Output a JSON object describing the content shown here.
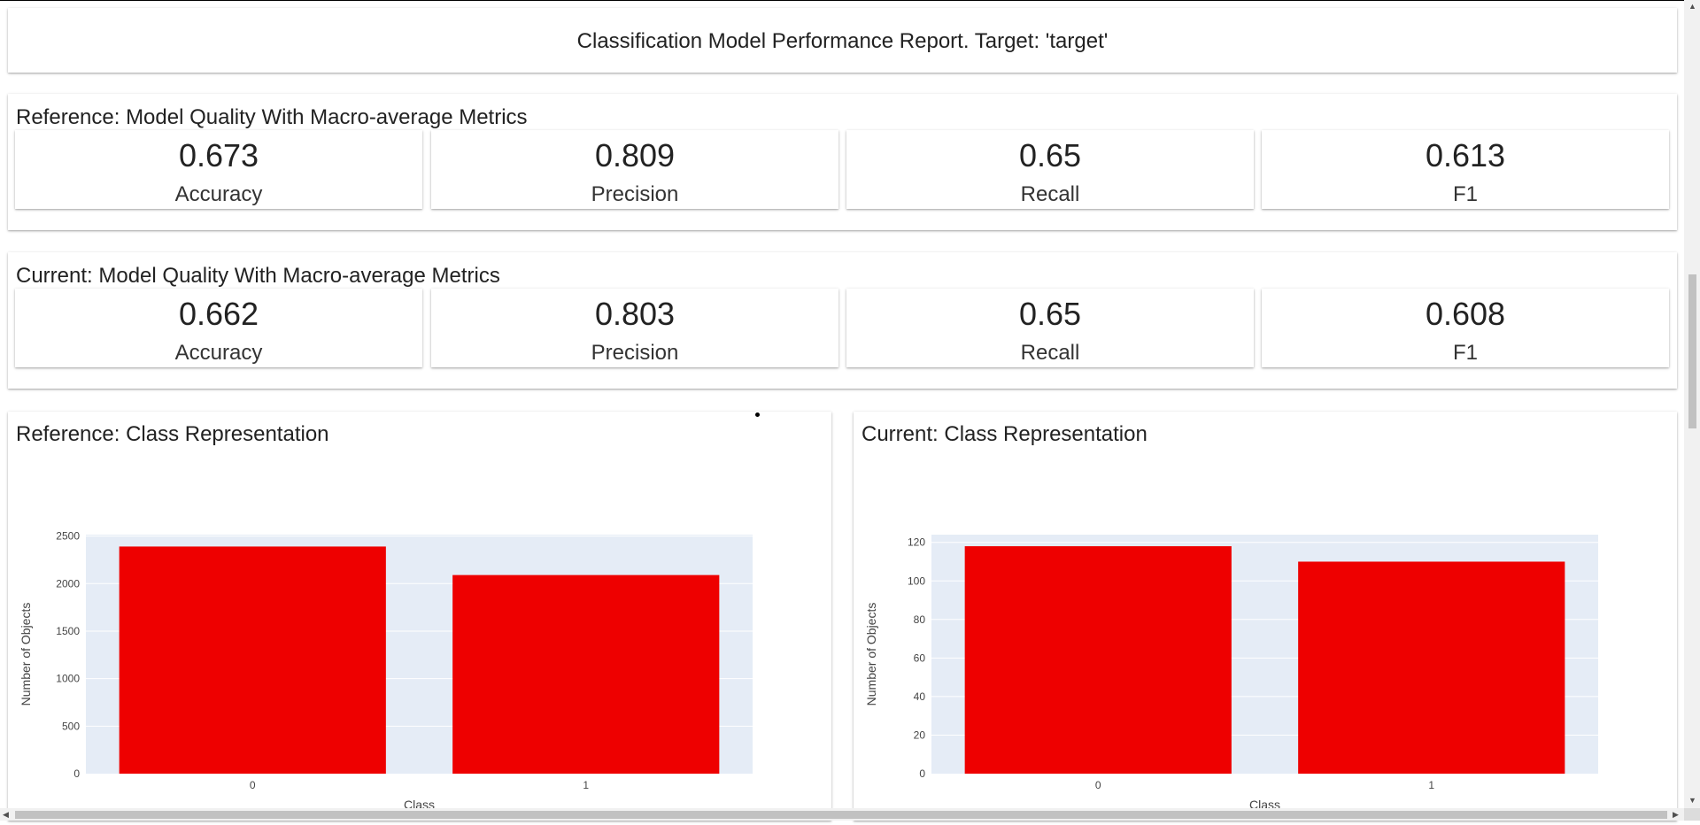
{
  "header": {
    "title": "Classification Model Performance Report. Target: 'target'"
  },
  "reference_quality": {
    "title": "Reference: Model Quality With Macro-average Metrics",
    "metrics": [
      {
        "value": "0.673",
        "label": "Accuracy"
      },
      {
        "value": "0.809",
        "label": "Precision"
      },
      {
        "value": "0.65",
        "label": "Recall"
      },
      {
        "value": "0.613",
        "label": "F1"
      }
    ]
  },
  "current_quality": {
    "title": "Current: Model Quality With Macro-average Metrics",
    "metrics": [
      {
        "value": "0.662",
        "label": "Accuracy"
      },
      {
        "value": "0.803",
        "label": "Precision"
      },
      {
        "value": "0.65",
        "label": "Recall"
      },
      {
        "value": "0.608",
        "label": "F1"
      }
    ]
  },
  "colors": {
    "bar": "#ee0000",
    "plot_bg": "#e5ecf6",
    "axis_text": "#444444"
  },
  "chart_data": [
    {
      "type": "bar",
      "title": "Reference: Class Representation",
      "categories": [
        "0",
        "1"
      ],
      "values": [
        2390,
        2090
      ],
      "xlabel": "Class",
      "ylabel": "Number of Objects",
      "yticks": [
        0,
        500,
        1000,
        1500,
        2000,
        2500
      ],
      "ylim": [
        0,
        2515
      ]
    },
    {
      "type": "bar",
      "title": "Current: Class Representation",
      "categories": [
        "0",
        "1"
      ],
      "values": [
        118,
        110
      ],
      "xlabel": "Class",
      "ylabel": "Number of Objects",
      "yticks": [
        0,
        20,
        40,
        60,
        80,
        100,
        120
      ],
      "ylim": [
        0,
        124
      ]
    }
  ],
  "scrollbars": {
    "up_icon": "triangle-up-icon",
    "down_icon": "triangle-down-icon",
    "left_icon": "triangle-left-icon",
    "right_icon": "triangle-right-icon"
  }
}
